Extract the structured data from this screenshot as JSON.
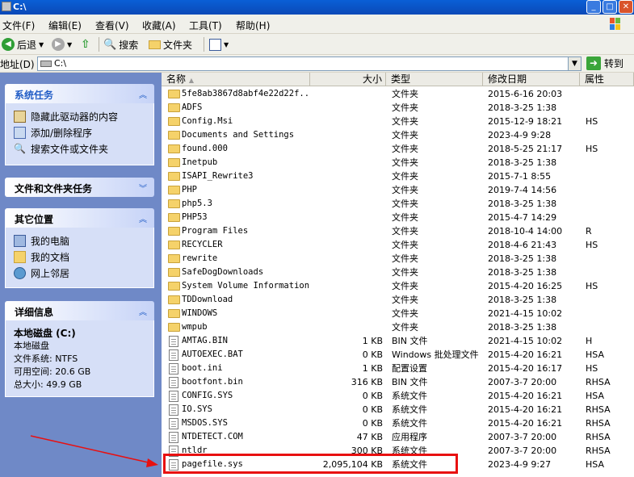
{
  "window": {
    "title": "C:\\"
  },
  "menu": [
    "文件(F)",
    "编辑(E)",
    "查看(V)",
    "收藏(A)",
    "工具(T)",
    "帮助(H)"
  ],
  "toolbar": {
    "back": "后退",
    "search": "搜索",
    "folders": "文件夹"
  },
  "address": {
    "label": "地址(D)",
    "value": "C:\\",
    "go": "转到"
  },
  "left": {
    "system_tasks": {
      "title": "系统任务",
      "items": [
        "隐藏此驱动器的内容",
        "添加/删除程序",
        "搜索文件或文件夹"
      ]
    },
    "file_tasks": {
      "title": "文件和文件夹任务"
    },
    "other_places": {
      "title": "其它位置",
      "items": [
        "我的电脑",
        "我的文档",
        "网上邻居"
      ]
    },
    "details": {
      "title": "详细信息",
      "name": "本地磁盘 (C:)",
      "type": "本地磁盘",
      "fs": "文件系统: NTFS",
      "free": "可用空间: 20.6 GB",
      "total": "总大小: 49.9 GB"
    }
  },
  "columns": {
    "name": "名称",
    "size": "大小",
    "type": "类型",
    "modified": "修改日期",
    "attr": "属性"
  },
  "files": [
    {
      "icon": "folder",
      "name": "5fe8ab3867d8abf4e22d22f...",
      "size": "",
      "type": "文件夹",
      "date": "2015-6-16 20:03",
      "attr": ""
    },
    {
      "icon": "folder",
      "name": "ADFS",
      "size": "",
      "type": "文件夹",
      "date": "2018-3-25 1:38",
      "attr": ""
    },
    {
      "icon": "folder",
      "name": "Config.Msi",
      "size": "",
      "type": "文件夹",
      "date": "2015-12-9 18:21",
      "attr": "HS"
    },
    {
      "icon": "folder",
      "name": "Documents and Settings",
      "size": "",
      "type": "文件夹",
      "date": "2023-4-9 9:28",
      "attr": ""
    },
    {
      "icon": "folder",
      "name": "found.000",
      "size": "",
      "type": "文件夹",
      "date": "2018-5-25 21:17",
      "attr": "HS"
    },
    {
      "icon": "folder",
      "name": "Inetpub",
      "size": "",
      "type": "文件夹",
      "date": "2018-3-25 1:38",
      "attr": ""
    },
    {
      "icon": "folder",
      "name": "ISAPI_Rewrite3",
      "size": "",
      "type": "文件夹",
      "date": "2015-7-1 8:55",
      "attr": ""
    },
    {
      "icon": "folder",
      "name": "PHP",
      "size": "",
      "type": "文件夹",
      "date": "2019-7-4 14:56",
      "attr": ""
    },
    {
      "icon": "folder",
      "name": "php5.3",
      "size": "",
      "type": "文件夹",
      "date": "2018-3-25 1:38",
      "attr": ""
    },
    {
      "icon": "folder",
      "name": "PHP53",
      "size": "",
      "type": "文件夹",
      "date": "2015-4-7 14:29",
      "attr": ""
    },
    {
      "icon": "folder",
      "name": "Program Files",
      "size": "",
      "type": "文件夹",
      "date": "2018-10-4 14:00",
      "attr": "R"
    },
    {
      "icon": "folder",
      "name": "RECYCLER",
      "size": "",
      "type": "文件夹",
      "date": "2018-4-6 21:43",
      "attr": "HS"
    },
    {
      "icon": "folder",
      "name": "rewrite",
      "size": "",
      "type": "文件夹",
      "date": "2018-3-25 1:38",
      "attr": ""
    },
    {
      "icon": "folder",
      "name": "SafeDogDownloads",
      "size": "",
      "type": "文件夹",
      "date": "2018-3-25 1:38",
      "attr": ""
    },
    {
      "icon": "folder",
      "name": "System Volume Information",
      "size": "",
      "type": "文件夹",
      "date": "2015-4-20 16:25",
      "attr": "HS"
    },
    {
      "icon": "folder",
      "name": "TDDownload",
      "size": "",
      "type": "文件夹",
      "date": "2018-3-25 1:38",
      "attr": ""
    },
    {
      "icon": "folder",
      "name": "WINDOWS",
      "size": "",
      "type": "文件夹",
      "date": "2021-4-15 10:02",
      "attr": ""
    },
    {
      "icon": "folder",
      "name": "wmpub",
      "size": "",
      "type": "文件夹",
      "date": "2018-3-25 1:38",
      "attr": ""
    },
    {
      "icon": "file",
      "name": "AMTAG.BIN",
      "size": "1 KB",
      "type": "BIN 文件",
      "date": "2021-4-15 10:02",
      "attr": "H"
    },
    {
      "icon": "file",
      "name": "AUTOEXEC.BAT",
      "size": "0 KB",
      "type": "Windows 批处理文件",
      "date": "2015-4-20 16:21",
      "attr": "HSA"
    },
    {
      "icon": "file",
      "name": "boot.ini",
      "size": "1 KB",
      "type": "配置设置",
      "date": "2015-4-20 16:17",
      "attr": "HS"
    },
    {
      "icon": "file",
      "name": "bootfont.bin",
      "size": "316 KB",
      "type": "BIN 文件",
      "date": "2007-3-7 20:00",
      "attr": "RHSA"
    },
    {
      "icon": "file",
      "name": "CONFIG.SYS",
      "size": "0 KB",
      "type": "系统文件",
      "date": "2015-4-20 16:21",
      "attr": "HSA"
    },
    {
      "icon": "file",
      "name": "IO.SYS",
      "size": "0 KB",
      "type": "系统文件",
      "date": "2015-4-20 16:21",
      "attr": "RHSA"
    },
    {
      "icon": "file",
      "name": "MSDOS.SYS",
      "size": "0 KB",
      "type": "系统文件",
      "date": "2015-4-20 16:21",
      "attr": "RHSA"
    },
    {
      "icon": "file",
      "name": "NTDETECT.COM",
      "size": "47 KB",
      "type": "应用程序",
      "date": "2007-3-7 20:00",
      "attr": "RHSA"
    },
    {
      "icon": "file",
      "name": "ntldr",
      "size": "300 KB",
      "type": "系统文件",
      "date": "2007-3-7 20:00",
      "attr": "RHSA"
    },
    {
      "icon": "file",
      "name": "pagefile.sys",
      "size": "2,095,104 KB",
      "type": "系统文件",
      "date": "2023-4-9 9:27",
      "attr": "HSA"
    }
  ],
  "colors": {
    "taskpane_bg": "#6f89c7",
    "highlight": "#e81010"
  }
}
